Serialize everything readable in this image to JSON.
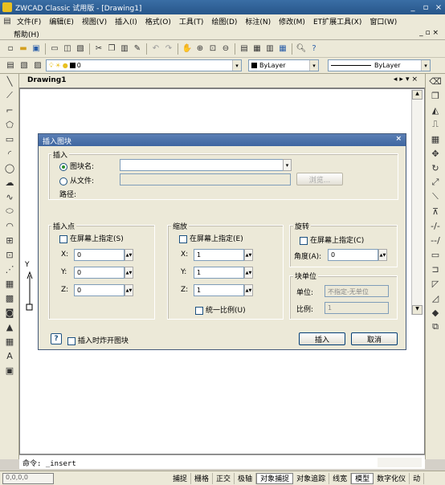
{
  "app": {
    "title": "ZWCAD Classic 试用版 - [Drawing1]"
  },
  "menu": {
    "row1": [
      "文件(F)",
      "编辑(E)",
      "视图(V)",
      "插入(I)",
      "格式(O)",
      "工具(T)",
      "绘图(D)",
      "标注(N)",
      "修改(M)",
      "ET扩展工具(X)",
      "窗口(W)"
    ],
    "row2": [
      "帮助(H)"
    ]
  },
  "layer_toolbar": {
    "layer_value": "0",
    "color_value": "ByLayer",
    "linetype_value": "ByLayer"
  },
  "drawing": {
    "tab": "Drawing1",
    "axis_label": "Y"
  },
  "command": {
    "prompt": "命令:",
    "text": "_insert"
  },
  "status": {
    "coords": "0,0,0,0",
    "buttons": [
      "捕捉",
      "栅格",
      "正交",
      "极轴",
      "对象捕捉",
      "对象追踪",
      "线宽",
      "模型",
      "数字化仪",
      "动"
    ]
  },
  "dialog": {
    "title": "插入图块",
    "insert_group": "插入",
    "block_name_label": "图块名:",
    "from_file_label": "从文件:",
    "browse_label": "浏览...",
    "path_label": "路径:",
    "block_name_value": "",
    "insertion_point": {
      "group": "插入点",
      "on_screen_label": "在屏幕上指定(S)",
      "x_label": "X:",
      "x_value": "0",
      "y_label": "Y:",
      "y_value": "0",
      "z_label": "Z:",
      "z_value": "0"
    },
    "scale": {
      "group": "缩放",
      "on_screen_label": "在屏幕上指定(E)",
      "x_label": "X:",
      "x_value": "1",
      "y_label": "Y:",
      "y_value": "1",
      "z_label": "Z:",
      "z_value": "1",
      "uniform_label": "统一比例(U)"
    },
    "rotation": {
      "group": "旋转",
      "on_screen_label": "在屏幕上指定(C)",
      "angle_label": "角度(A):",
      "angle_value": "0"
    },
    "block_unit": {
      "group": "块单位",
      "unit_label": "单位:",
      "unit_value": "不指定-无单位",
      "ratio_label": "比例:",
      "ratio_value": "1"
    },
    "explode_label": "插入时炸开图块",
    "help_icon": "?",
    "ok_label": "插入",
    "cancel_label": "取消"
  }
}
